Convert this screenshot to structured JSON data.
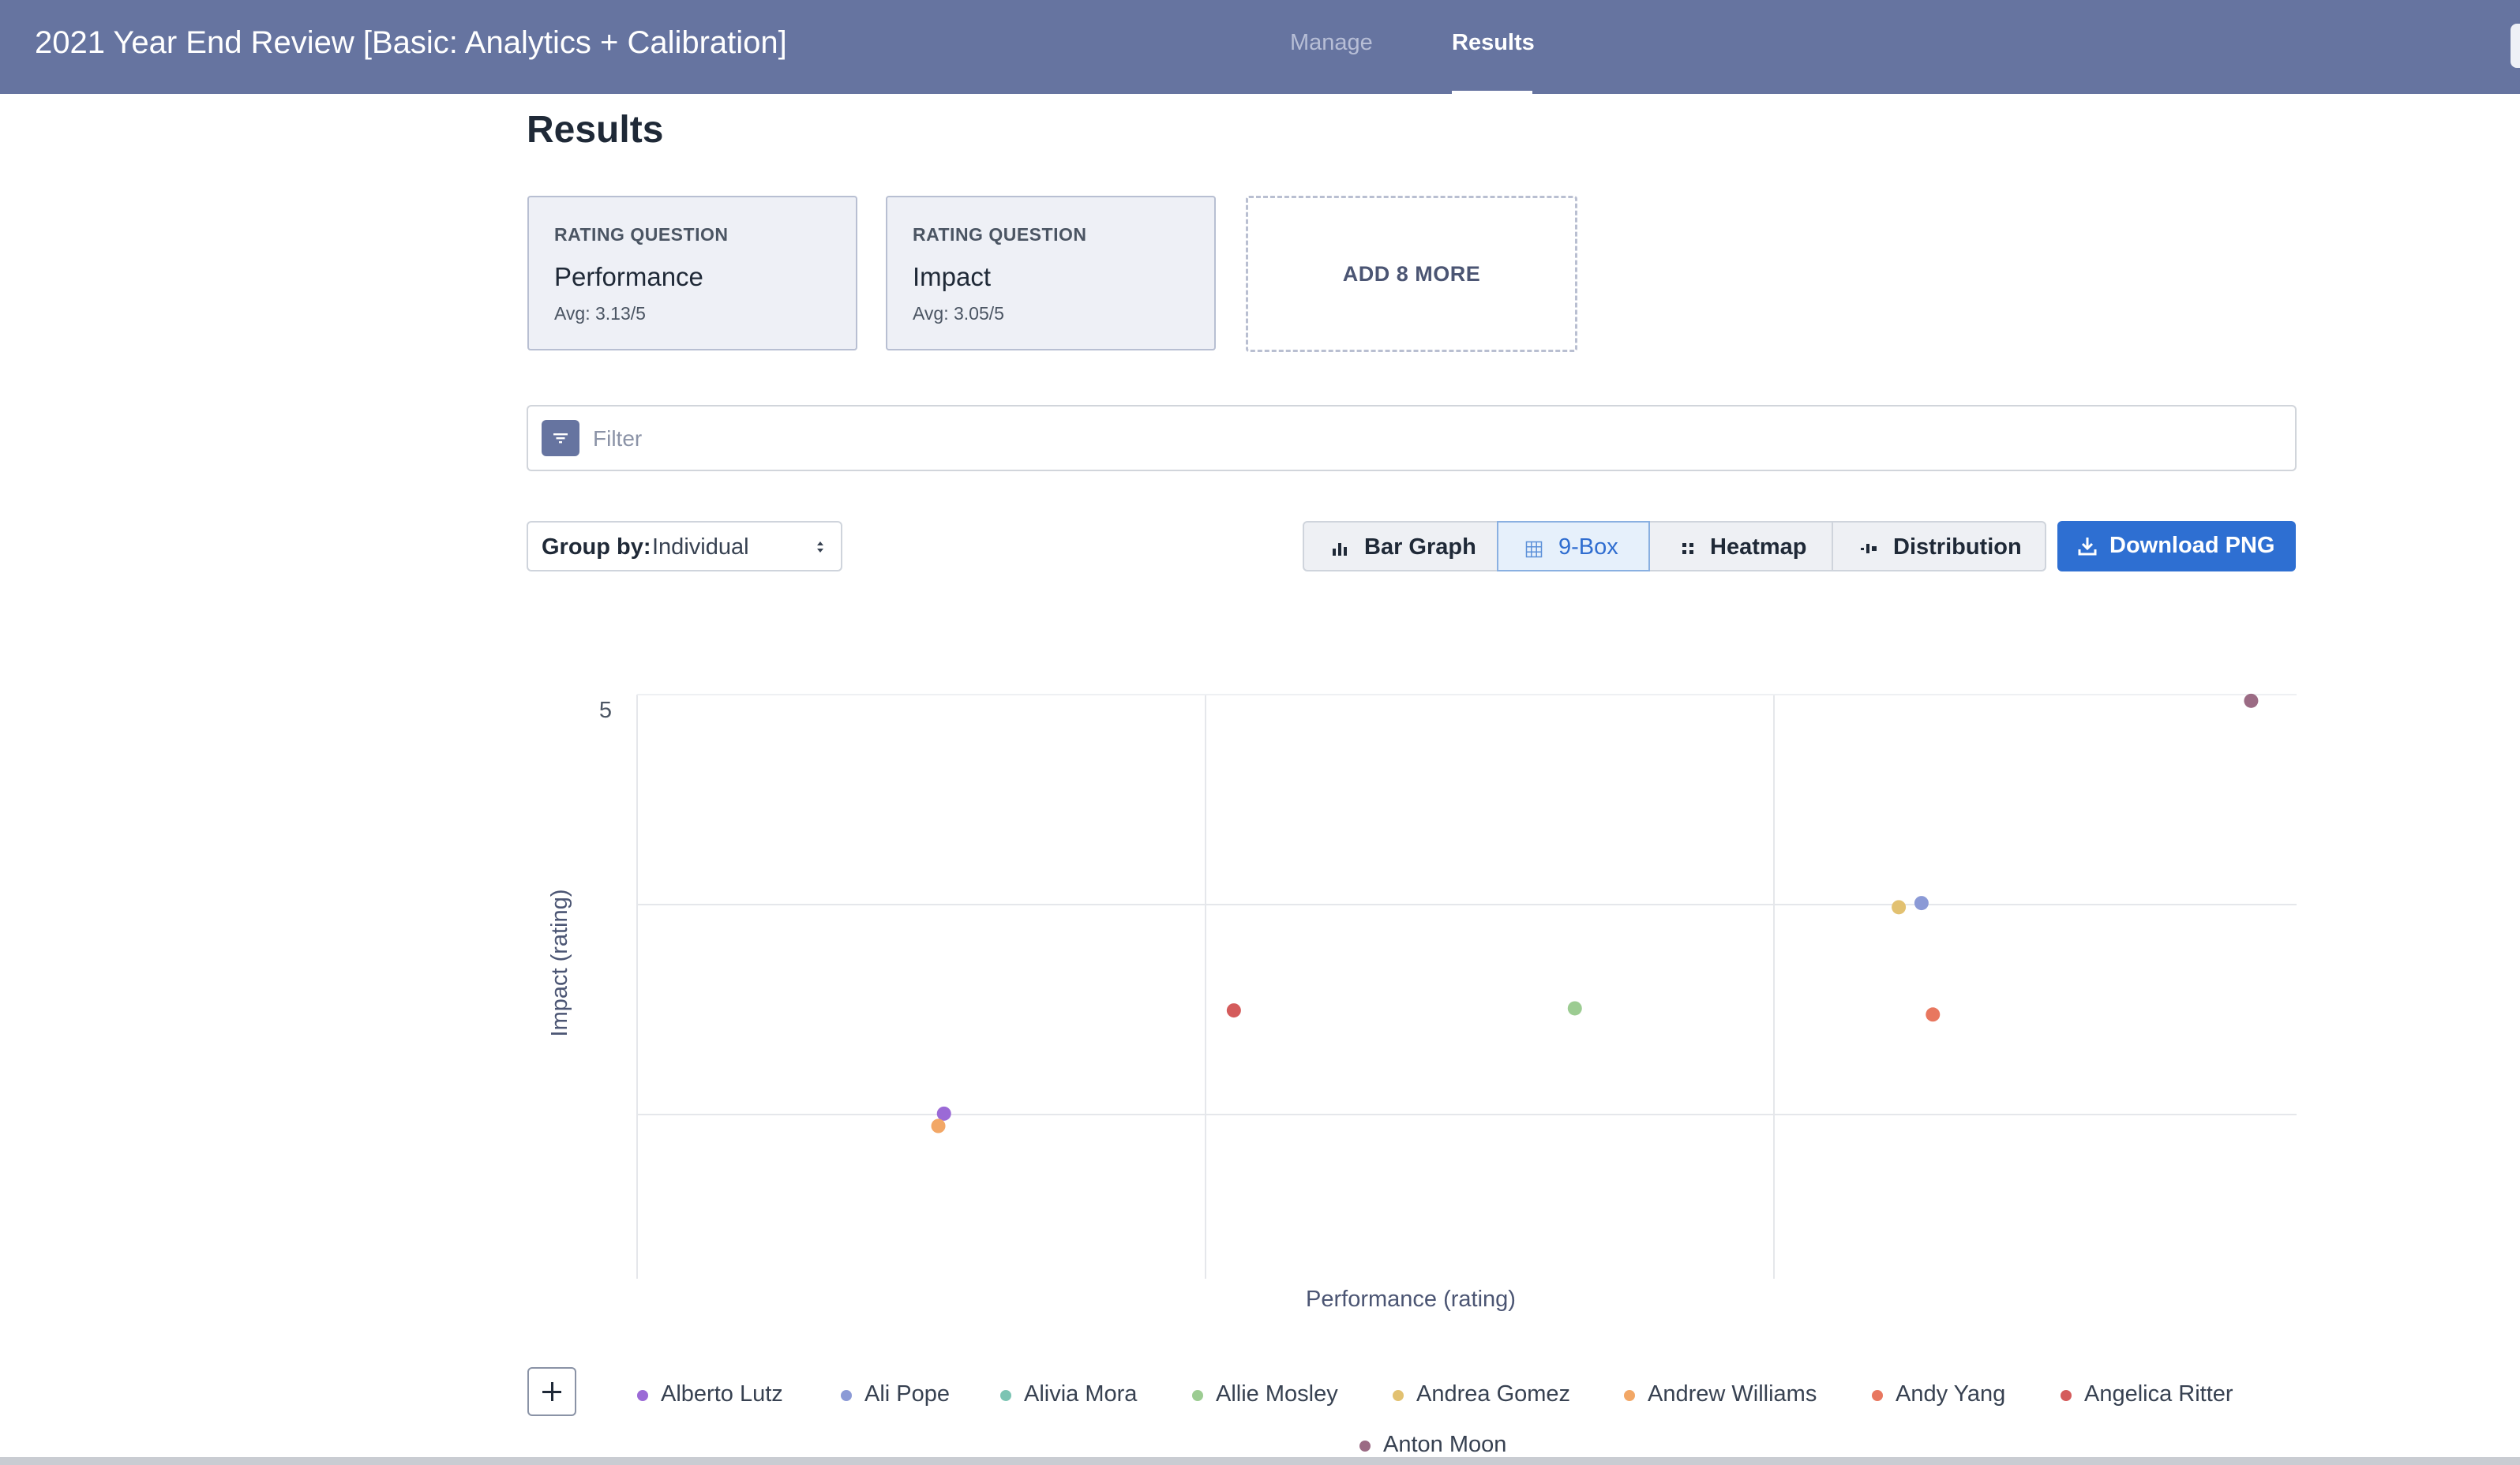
{
  "app": {
    "title": "2021 Year End Review [Basic: Analytics + Calibration]",
    "nav": [
      {
        "label": "Manage",
        "active": false
      },
      {
        "label": "Results",
        "active": true
      }
    ],
    "colors": {
      "header_bg": "#6674a0",
      "primary_button": "#2e6fd2",
      "active_segment": "#2f6dd0"
    }
  },
  "page": {
    "title": "Results"
  },
  "questions": [
    {
      "type_label": "RATING QUESTION",
      "name": "Performance",
      "avg": "Avg: 3.13/5"
    },
    {
      "type_label": "RATING QUESTION",
      "name": "Impact",
      "avg": "Avg: 3.05/5"
    }
  ],
  "add_more": {
    "label": "ADD 8 MORE"
  },
  "filter": {
    "placeholder": "Filter",
    "value": "",
    "icon": "filter-icon"
  },
  "controls": {
    "group_by_label": "Group by:",
    "group_by_value": "Individual",
    "views": [
      {
        "label": "Bar Graph",
        "icon": "bar-chart-icon",
        "active": false
      },
      {
        "label": "9-Box",
        "icon": "grid-icon",
        "active": true
      },
      {
        "label": "Heatmap",
        "icon": "heatmap-icon",
        "active": false
      },
      {
        "label": "Distribution",
        "icon": "distribution-icon",
        "active": false
      }
    ],
    "download_label": "Download PNG"
  },
  "chart_data": {
    "type": "scatter",
    "title": "",
    "xlabel": "Performance (rating)",
    "ylabel": "Impact (rating)",
    "xlim": [
      2.1,
      5.02
    ],
    "ylim": [
      2.2,
      5.03
    ],
    "y_tick_labels": [
      "5"
    ],
    "grid": "3x3 nine-box",
    "legend_position": "bottom",
    "series": [
      {
        "name": "Alberto Lutz",
        "color": "#9b6ad6",
        "x": 2.64,
        "y": 3.0
      },
      {
        "name": "Ali Pope",
        "color": "#8b9ad6",
        "x": 4.36,
        "y": 4.02
      },
      {
        "name": "Alivia Mora",
        "color": "#7cc4b3",
        "x": null,
        "y": null
      },
      {
        "name": "Allie Mosley",
        "color": "#9ccc92",
        "x": 3.75,
        "y": 3.51
      },
      {
        "name": "Andrea Gomez",
        "color": "#e2c171",
        "x": 4.32,
        "y": 4.0
      },
      {
        "name": "Andrew Williams",
        "color": "#f2a766",
        "x": 2.63,
        "y": 2.94
      },
      {
        "name": "Andy Yang",
        "color": "#e8775f",
        "x": 4.38,
        "y": 3.48
      },
      {
        "name": "Angelica Ritter",
        "color": "#d45b5b",
        "x": 3.15,
        "y": 3.5
      },
      {
        "name": "Anton Moon",
        "color": "#9b6b84",
        "x": 4.94,
        "y": 5.0
      }
    ]
  }
}
